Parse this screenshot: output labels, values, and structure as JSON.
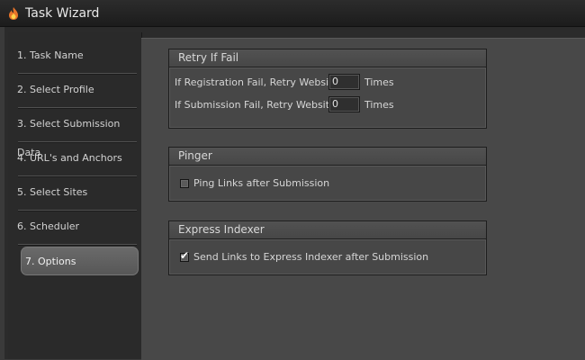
{
  "window": {
    "title": "Task Wizard",
    "icon": "flame-icon"
  },
  "sidebar": {
    "items": [
      {
        "label": "1. Task Name",
        "active": false
      },
      {
        "label": "2. Select Profile",
        "active": false
      },
      {
        "label": "3. Select Submission Data",
        "active": false
      },
      {
        "label": "4. URL's and Anchors",
        "active": false
      },
      {
        "label": "5. Select Sites",
        "active": false
      },
      {
        "label": "6. Scheduler",
        "active": false
      },
      {
        "label": "7. Options",
        "active": true
      }
    ]
  },
  "retry": {
    "title": "Retry If Fail",
    "registration_label": "If Registration Fail, Retry Website",
    "registration_value": "0",
    "submission_label": "If Submission Fail, Retry Website",
    "submission_value": "0",
    "times_label": "Times"
  },
  "pinger": {
    "title": "Pinger",
    "option_label": "Ping Links after Submission",
    "checked": false
  },
  "express": {
    "title": "Express Indexer",
    "option_label": "Send Links to Express Indexer after Submission",
    "checked": true
  },
  "colors": {
    "background": "#3a3a3a",
    "panel": "#484848",
    "active_item": "#626262"
  }
}
